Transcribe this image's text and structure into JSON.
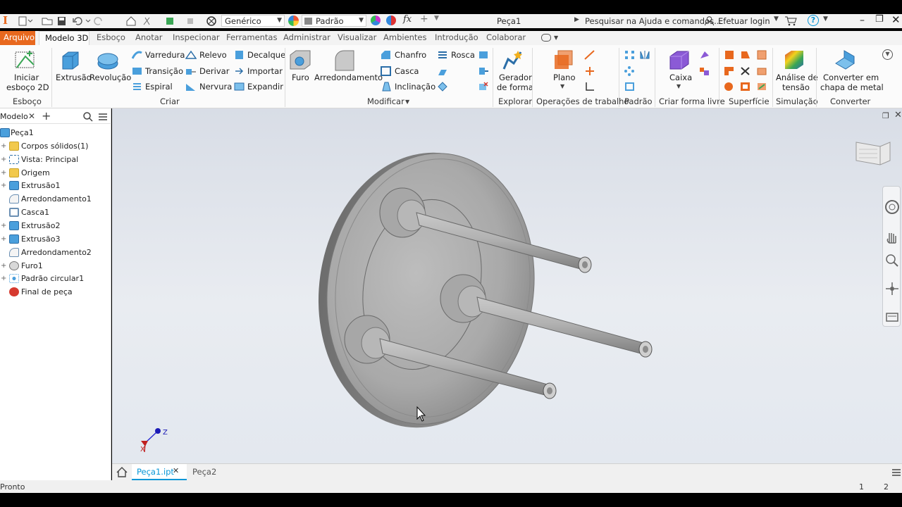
{
  "titlebar": {
    "app_logo": "I",
    "material": "Genérico",
    "appearance": "Padrão",
    "fx_label": "fx",
    "document_title": "Peça1",
    "help_search": "Pesquisar na Ajuda e comandos...",
    "login": "Efetuar login"
  },
  "tabs": [
    "Arquivo",
    "Modelo 3D",
    "Esboço",
    "Anotar",
    "Inspecionar",
    "Ferramentas",
    "Administrar",
    "Visualizar",
    "Ambientes",
    "Introdução",
    "Colaborar"
  ],
  "ribbon": {
    "sketch_start": "Iniciar esboço 2D",
    "sketch_start_l1": "Iniciar",
    "sketch_start_l2": "esboço 2D",
    "extrusao": "Extrusão",
    "revolucao": "Revolução",
    "varredura": "Varredura",
    "transicao": "Transição",
    "espiral": "Espiral",
    "relevo": "Relevo",
    "derivar": "Derivar",
    "nervura": "Nervura",
    "decalque": "Decalque",
    "importar": "Importar",
    "expandir": "Expandir",
    "furo": "Furo",
    "arredondamento": "Arredondamento",
    "chanfro": "Chanfro",
    "casca": "Casca",
    "inclinacao": "Inclinação",
    "rosca": "Rosca",
    "gerador_l1": "Gerador",
    "gerador_l2": "de forma",
    "plano": "Plano",
    "caixa": "Caixa",
    "analise_l1": "Análise de",
    "analise_l2": "tensão",
    "converter_l1": "Converter em",
    "converter_l2": "chapa de metal",
    "groups": {
      "esboco": "Esboço",
      "criar": "Criar",
      "modificar": "Modificar",
      "explorar": "Explorar",
      "operacoes": "Operações de trabalho",
      "padrao": "Padrão",
      "forma_livre": "Criar forma livre",
      "superficie": "Superfície",
      "simulacao": "Simulação",
      "converter": "Converter"
    }
  },
  "browser": {
    "tab_label": "Modelo",
    "items": [
      {
        "label": "Peça1",
        "icon": "part-icon",
        "expandable": false
      },
      {
        "label": "Corpos sólidos(1)",
        "icon": "folder-icon",
        "expandable": true
      },
      {
        "label": "Vista: Principal",
        "icon": "view-icon",
        "expandable": true
      },
      {
        "label": "Origem",
        "icon": "folder-icon",
        "expandable": true
      },
      {
        "label": "Extrusão1",
        "icon": "extrude-icon",
        "expandable": true
      },
      {
        "label": "Arredondamento1",
        "icon": "fillet-icon",
        "expandable": false
      },
      {
        "label": "Casca1",
        "icon": "shell-icon",
        "expandable": false
      },
      {
        "label": "Extrusão2",
        "icon": "extrude-icon",
        "expandable": true
      },
      {
        "label": "Extrusão3",
        "icon": "extrude-icon",
        "expandable": true
      },
      {
        "label": "Arredondamento2",
        "icon": "fillet-icon",
        "expandable": false
      },
      {
        "label": "Furo1",
        "icon": "hole-icon",
        "expandable": true
      },
      {
        "label": "Padrão circular1",
        "icon": "pattern-icon",
        "expandable": true
      },
      {
        "label": "Final de peça",
        "icon": "end-of-part-icon",
        "expandable": false
      }
    ]
  },
  "axes": {
    "z": "Z",
    "x": "X"
  },
  "doc_tabs": [
    {
      "label": "Peça1.ipt",
      "active": true
    },
    {
      "label": "Peça2",
      "active": false
    }
  ],
  "status": {
    "text": "Pronto",
    "count1": "1",
    "count2": "2"
  },
  "colors": {
    "accent": "#0696d7",
    "file_tab": "#e8681e",
    "end_icon": "#d63a2f"
  }
}
